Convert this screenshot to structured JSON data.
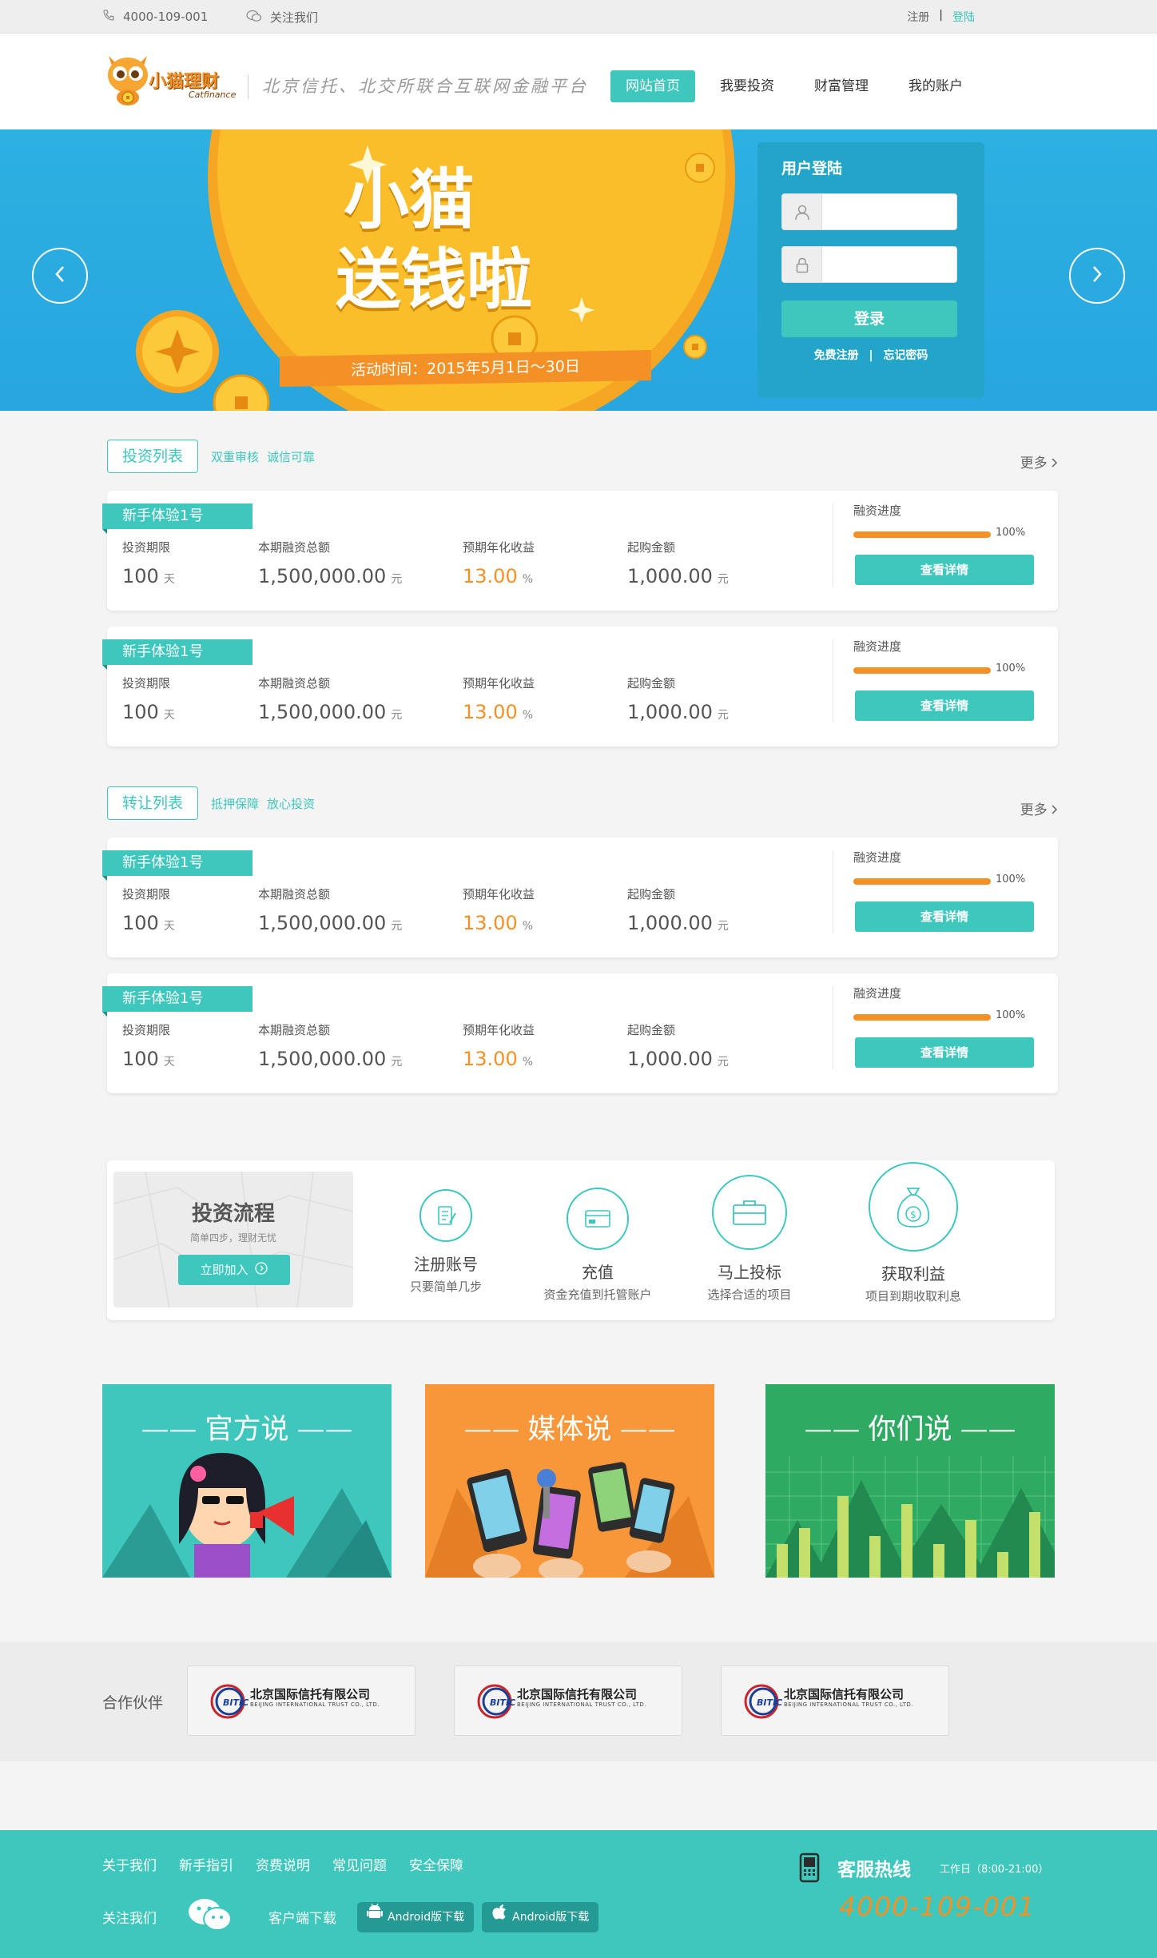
{
  "topbar": {
    "phone": "4000-109-001",
    "follow": "关注我们",
    "register": "注册",
    "separator": "|",
    "login": "登陆"
  },
  "header": {
    "logo_text": "小猫理财",
    "logo_sub": "Catfinance",
    "slogan": "北京信托、北交所联合互联网金融平台",
    "nav": [
      "网站首页",
      "我要投资",
      "财富管理",
      "我的账户"
    ]
  },
  "banner": {
    "promo_line1": "小猫",
    "promo_line2": "送钱啦",
    "activity": "活动时间：2015年5月1日～30日",
    "login_title": "用户登陆",
    "login_button": "登录",
    "register_link": "免费注册",
    "links_sep": "|",
    "forgot_link": "忘记密码"
  },
  "invest_section": {
    "tag": "投资列表",
    "sub1": "双重审核",
    "sub2": "诚信可靠",
    "more": "更多"
  },
  "transfer_section": {
    "tag": "转让列表",
    "sub1": "抵押保障",
    "sub2": "放心投资",
    "more": "更多"
  },
  "card_labels": {
    "term": "投资期限",
    "total": "本期融资总额",
    "rate": "预期年化收益",
    "min": "起购金额",
    "progress": "融资进度",
    "detail": "查看详情",
    "unit_day": "天",
    "unit_yuan": "元",
    "unit_pct": "%"
  },
  "products": [
    {
      "name": "新手体验1号",
      "term": "100",
      "total": "1,500,000.00",
      "rate": "13.00",
      "min": "1,000.00",
      "progress": 1.0,
      "progress_label": "100%"
    },
    {
      "name": "新手体验1号",
      "term": "100",
      "total": "1,500,000.00",
      "rate": "13.00",
      "min": "1,000.00",
      "progress": 1.0,
      "progress_label": "100%"
    }
  ],
  "transfers": [
    {
      "name": "新手体验1号",
      "term": "100",
      "total": "1,500,000.00",
      "rate": "13.00",
      "min": "1,000.00",
      "progress": 1.0,
      "progress_label": "100%"
    },
    {
      "name": "新手体验1号",
      "term": "100",
      "total": "1,500,000.00",
      "rate": "13.00",
      "min": "1,000.00",
      "progress": 1.0,
      "progress_label": "100%"
    }
  ],
  "process": {
    "title": "投资流程",
    "subtitle": "简单四步，理财无忧",
    "join": "立即加入",
    "steps": [
      {
        "name": "注册账号",
        "desc": "只要简单几步",
        "icon": "register-icon"
      },
      {
        "name": "充值",
        "desc": "资金充值到托管账户",
        "icon": "card-icon"
      },
      {
        "name": "马上投标",
        "desc": "选择合适的项目",
        "icon": "briefcase-icon"
      },
      {
        "name": "获取利益",
        "desc": "项目到期收取利息",
        "icon": "moneybag-icon"
      }
    ]
  },
  "panels": [
    {
      "title": "官方说",
      "color": "#3ec7bd"
    },
    {
      "title": "媒体说",
      "color": "#f8963a"
    },
    {
      "title": "你们说",
      "color": "#2eaa62"
    }
  ],
  "partners": {
    "label": "合作伙伴",
    "items": [
      {
        "logo": "BITIC",
        "cn": "北京国际信托有限公司",
        "en": "BEIJING INTERNATIONAL TRUST CO., LTD."
      },
      {
        "logo": "BITIC",
        "cn": "北京国际信托有限公司",
        "en": "BEIJING INTERNATIONAL TRUST CO., LTD."
      },
      {
        "logo": "BITIC",
        "cn": "北京国际信托有限公司",
        "en": "BEIJING INTERNATIONAL TRUST CO., LTD."
      }
    ]
  },
  "footer": {
    "links": [
      "关于我们",
      "新手指引",
      "资费说明",
      "常见问题",
      "安全保障"
    ],
    "follow": "关注我们",
    "client_download": "客户端下载",
    "android": "Android版下载",
    "ios": "Android版下载",
    "hotline_title": "客服热线",
    "hotline_time": "工作日（8:00-21:00）",
    "hotline_number": "4000-109-001"
  },
  "colors": {
    "accent": "#3ec7bd",
    "orange": "#f39126",
    "banner_blue": "#2aaae0"
  }
}
